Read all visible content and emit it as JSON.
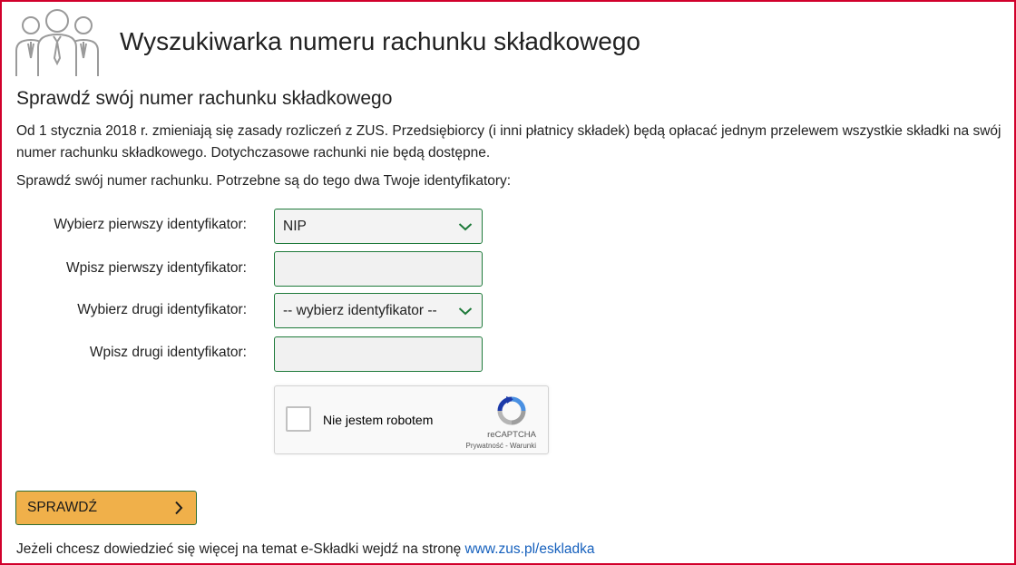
{
  "header": {
    "title": "Wyszukiwarka numeru rachunku składkowego",
    "icon": "people-group-icon"
  },
  "section": {
    "title": "Sprawdź swój numer rachunku składkowego",
    "intro": "Od 1 stycznia 2018 r. zmieniają się zasady rozliczeń z ZUS. Przedsiębiorcy (i inni płatnicy składek) będą opłacać jednym przelewem wszystkie składki na swój numer rachunku składkowego. Dotychczasowe rachunki nie będą dostępne.",
    "prompt": "Sprawdź swój numer rachunku. Potrzebne są do tego dwa Twoje identyfikatory:"
  },
  "form": {
    "first_select_label": "Wybierz pierwszy identyfikator:",
    "first_select_value": "NIP",
    "first_input_label": "Wpisz pierwszy identyfikator:",
    "first_input_value": "",
    "second_select_label": "Wybierz drugi identyfikator:",
    "second_select_value": "-- wybierz identyfikator --",
    "second_input_label": "Wpisz drugi identyfikator:",
    "second_input_value": ""
  },
  "captcha": {
    "label": "Nie jestem robotem",
    "brand": "reCAPTCHA",
    "links": "Prywatność - Warunki"
  },
  "actions": {
    "check_label": "SPRAWDŹ"
  },
  "footer": {
    "text": "Jeżeli chcesz dowiedzieć się więcej na temat e-Składki wejdź na stronę ",
    "link": "www.zus.pl/eskladka"
  },
  "colors": {
    "border_accent": "#d1002b",
    "field_border": "#1e7a3a",
    "button_bg": "#f0b04a",
    "link": "#1560bd"
  }
}
